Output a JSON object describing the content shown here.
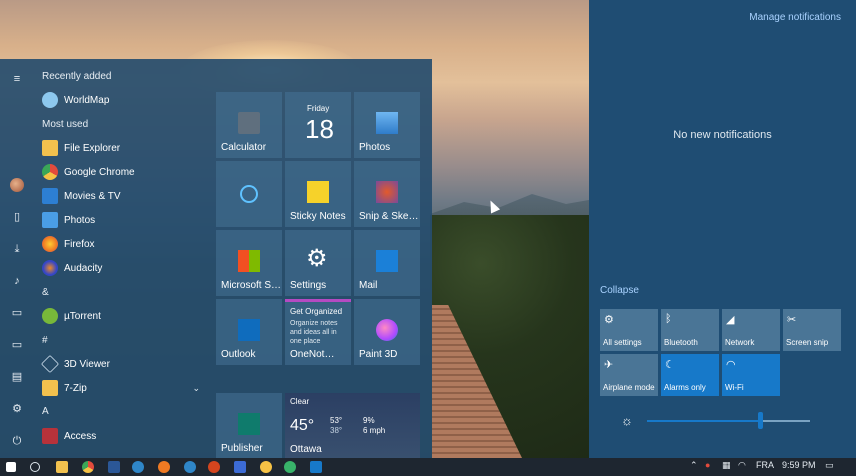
{
  "desktop": {},
  "start_menu": {
    "recently_added": "Recently added",
    "most_used": "Most used",
    "apps": [
      {
        "label": "WorldMap",
        "color": "#8dc8ee"
      },
      {
        "label": "File Explorer",
        "color": "#f2c14e"
      },
      {
        "label": "Google Chrome",
        "color": "#e34b3c"
      },
      {
        "label": "Movies & TV",
        "color": "#2d7fd3"
      },
      {
        "label": "Photos",
        "color": "#4a9ee6"
      },
      {
        "label": "Firefox",
        "color": "#f07a23"
      },
      {
        "label": "Audacity",
        "color": "#3446c7"
      }
    ],
    "section_amp": "&",
    "app_utorrent": "µTorrent",
    "section_hash": "#",
    "app_3dviewer": "3D Viewer",
    "app_7zip": "7-Zip",
    "section_a": "A",
    "app_access": "Access",
    "tiles": {
      "calculator": "Calculator",
      "calendar_day": "Friday",
      "calendar_date": "18",
      "photos": "Photos",
      "cortana": "",
      "sticky_notes": "Sticky Notes",
      "snip_sketch": "Snip & Ske…",
      "ms_store": "Microsoft S…",
      "settings": "Settings",
      "mail": "Mail",
      "outlook": "Outlook",
      "onenote_title": "Get Organized",
      "onenote_body": "Organize notes and ideas all in one place",
      "onenote": "OneNot…",
      "paint3d": "Paint 3D",
      "publisher": "Publisher",
      "weather_cond": "Clear",
      "weather_temp": "45°",
      "weather_hi": "53°",
      "weather_lo": "38°",
      "weather_humidity": "9%",
      "weather_wind": "6 mph",
      "weather_city": "Ottawa"
    }
  },
  "action_center": {
    "manage": "Manage notifications",
    "empty": "No new notifications",
    "collapse": "Collapse",
    "quick_actions": [
      {
        "label": "All settings",
        "icon": "gear-icon",
        "on": false
      },
      {
        "label": "Bluetooth",
        "icon": "bluetooth-icon",
        "on": false
      },
      {
        "label": "Network",
        "icon": "network-icon",
        "on": false
      },
      {
        "label": "Screen snip",
        "icon": "snip-icon",
        "on": false
      },
      {
        "label": "Airplane mode",
        "icon": "airplane-icon",
        "on": false
      },
      {
        "label": "Alarms only",
        "icon": "moon-icon",
        "on": true
      },
      {
        "label": "Wi-Fi",
        "icon": "wifi-icon",
        "on": true
      }
    ],
    "brightness": 0.7
  },
  "taskbar": {
    "language": "FRA",
    "time": "9:59 PM"
  },
  "colors": {
    "accent": "#1779c9",
    "action_bg": "#1f4d73",
    "start_bg": "#274e6e"
  }
}
